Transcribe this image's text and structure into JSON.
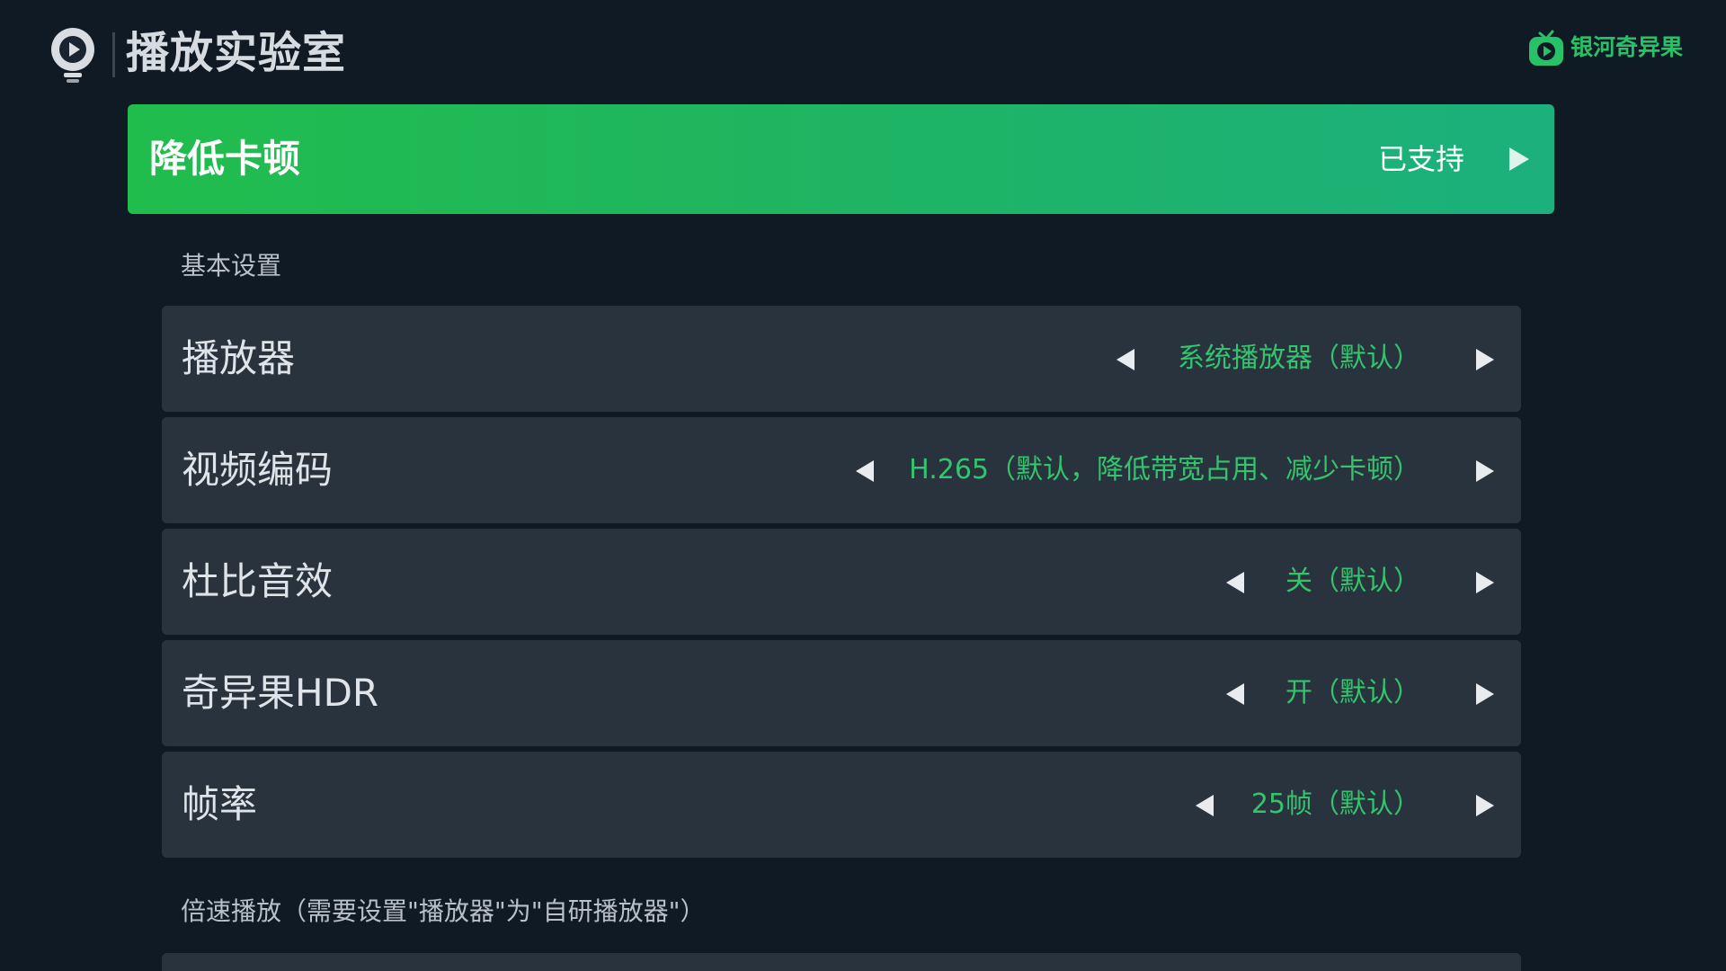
{
  "header": {
    "title": "播放实验室",
    "brand_name": "银河奇异果",
    "brand_color": "#27c268"
  },
  "banner": {
    "title": "降低卡顿",
    "status": "已支持",
    "gradient_start": "#20bd4d",
    "gradient_end": "#1cb07d"
  },
  "sections": {
    "basic": "基本设置",
    "speed": "倍速播放（需要设置\"播放器\"为\"自研播放器\"）"
  },
  "settings": [
    {
      "label": "播放器",
      "value": "系统播放器（默认）"
    },
    {
      "label": "视频编码",
      "value": "H.265（默认，降低带宽占用、减少卡顿）"
    },
    {
      "label": "杜比音效",
      "value": "关（默认）"
    },
    {
      "label": "奇异果HDR",
      "value": "开（默认）"
    },
    {
      "label": "帧率",
      "value": "25帧（默认）"
    }
  ],
  "colors": {
    "background": "#101a25",
    "row_background": "#29333e",
    "value_text": "#35c46e",
    "arrow": "#e8ecef"
  },
  "icons": {
    "header": "lab-play-icon",
    "brand": "tv-play-icon",
    "banner_arrow": "chevron-right-icon",
    "row_prev": "triangle-left-icon",
    "row_next": "triangle-right-icon"
  }
}
